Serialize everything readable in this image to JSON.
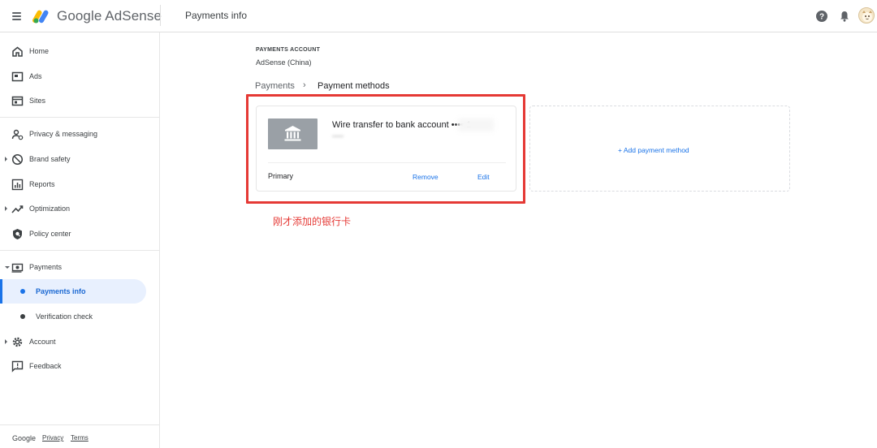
{
  "app": {
    "logo_text": "Google AdSense",
    "page_title": "Payments info"
  },
  "colors": {
    "accent": "#1a73e8",
    "annotation": "#e53935",
    "active_bg": "#e8f0fe"
  },
  "sidebar": {
    "items": [
      {
        "label": "Home",
        "icon": "home-icon"
      },
      {
        "label": "Ads",
        "icon": "ads-icon"
      },
      {
        "label": "Sites",
        "icon": "sites-icon"
      },
      {
        "label": "Privacy & messaging",
        "icon": "privacy-icon"
      },
      {
        "label": "Brand safety",
        "icon": "brand-safety-icon"
      },
      {
        "label": "Reports",
        "icon": "reports-icon"
      },
      {
        "label": "Optimization",
        "icon": "optimization-icon"
      },
      {
        "label": "Policy center",
        "icon": "policy-icon"
      },
      {
        "label": "Payments",
        "icon": "payments-icon"
      },
      {
        "label": "Account",
        "icon": "gear-icon"
      },
      {
        "label": "Feedback",
        "icon": "feedback-icon"
      }
    ],
    "sub_items": [
      {
        "label": "Payments info"
      },
      {
        "label": "Verification check"
      }
    ],
    "footer": {
      "google": "Google",
      "privacy": "Privacy",
      "terms": "Terms"
    }
  },
  "main": {
    "account_heading": "PAYMENTS ACCOUNT",
    "account_name": "AdSense (China)",
    "breadcrumb": {
      "parent": "Payments",
      "separator": "›",
      "current": "Payment methods"
    },
    "payment_card": {
      "title": "Wire transfer to bank account •••• 1",
      "primary_label": "Primary",
      "remove_label": "Remove",
      "edit_label": "Edit"
    },
    "add_method_label": "+ Add payment method",
    "annotation": "刚才添加的银行卡"
  }
}
